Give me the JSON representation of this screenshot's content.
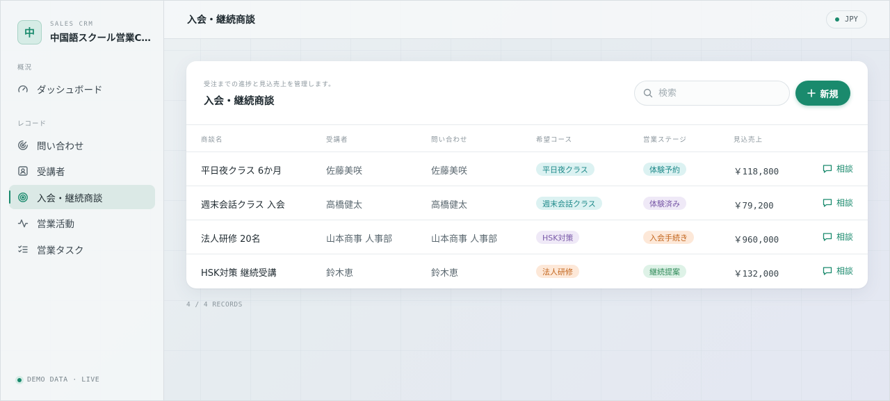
{
  "brand": {
    "logo_char": "中",
    "subtitle": "SALES CRM",
    "name": "中国語スクール営業CRM"
  },
  "sidebar": {
    "sections": [
      {
        "label": "概況"
      },
      {
        "label": "レコード"
      }
    ],
    "items": [
      {
        "label": "ダッシュボード",
        "icon": "gauge-icon",
        "active": false
      },
      {
        "label": "問い合わせ",
        "icon": "radar-icon",
        "active": false
      },
      {
        "label": "受講者",
        "icon": "contact-card-icon",
        "active": false
      },
      {
        "label": "入会・継続商談",
        "icon": "target-icon",
        "active": true
      },
      {
        "label": "営業活動",
        "icon": "activity-icon",
        "active": false
      },
      {
        "label": "営業タスク",
        "icon": "checklist-icon",
        "active": false
      }
    ],
    "status": "DEMO DATA · LIVE"
  },
  "header": {
    "title": "入会・継続商談",
    "currency": "JPY"
  },
  "card": {
    "description": "受注までの進捗と見込売上を管理します。",
    "title": "入会・継続商談",
    "search_placeholder": "検索",
    "new_label": "新規"
  },
  "table": {
    "columns": [
      "商談名",
      "受講者",
      "問い合わせ",
      "希望コース",
      "営業ステージ",
      "見込売上"
    ],
    "action_label": "相談",
    "rows": [
      {
        "name": "平日夜クラス 6か月",
        "student": "佐藤美咲",
        "inquiry": "佐藤美咲",
        "course": "平日夜クラス",
        "course_color": "teal",
        "stage": "体験予約",
        "stage_color": "teal",
        "amount": "￥118,800"
      },
      {
        "name": "週末会話クラス 入会",
        "student": "高橋健太",
        "inquiry": "高橋健太",
        "course": "週末会話クラス",
        "course_color": "teal",
        "stage": "体験済み",
        "stage_color": "purple",
        "amount": "￥79,200"
      },
      {
        "name": "法人研修 20名",
        "student": "山本商事 人事部",
        "inquiry": "山本商事 人事部",
        "course": "HSK対策",
        "course_color": "purple",
        "stage": "入会手続き",
        "stage_color": "orange",
        "amount": "￥960,000"
      },
      {
        "name": "HSK対策 継続受講",
        "student": "鈴木恵",
        "inquiry": "鈴木恵",
        "course": "法人研修",
        "course_color": "orange",
        "stage": "継続提案",
        "stage_color": "green",
        "amount": "￥132,000"
      }
    ]
  },
  "pill_colors": {
    "teal": {
      "bg": "#dcf2f2",
      "fg": "#1f8a8a"
    },
    "purple": {
      "bg": "#efe9f7",
      "fg": "#7a5aa8"
    },
    "orange": {
      "bg": "#fde8d8",
      "fg": "#c2651c"
    },
    "green": {
      "bg": "#def2e7",
      "fg": "#2f8a58"
    }
  },
  "accent": "#1a8a6d",
  "records": "4 / 4 RECORDS"
}
